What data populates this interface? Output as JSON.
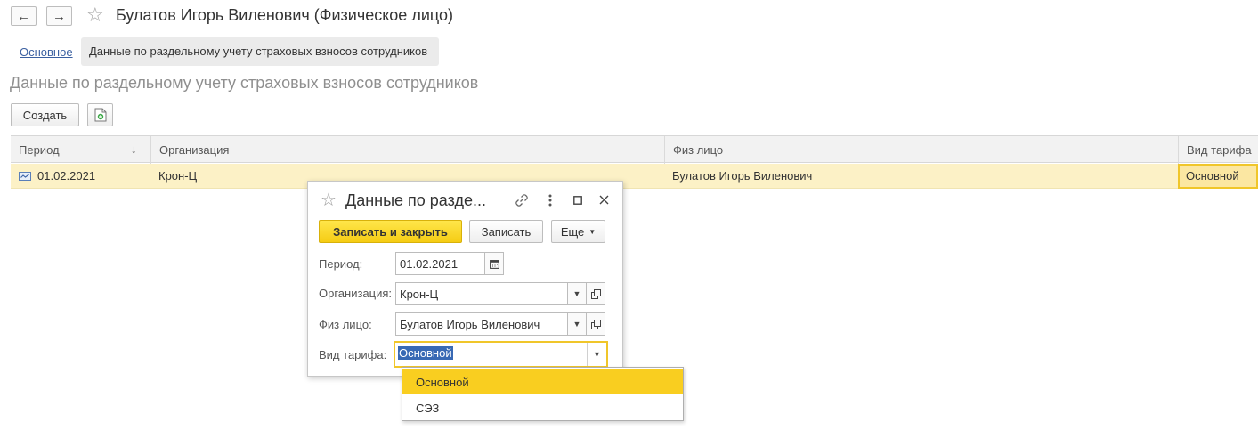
{
  "header": {
    "title": "Булатов Игорь Виленович (Физическое лицо)"
  },
  "tabs": [
    {
      "label": "Основное"
    },
    {
      "label": "Данные по раздельному учету страховых взносов сотрудников"
    }
  ],
  "section": {
    "title": "Данные по раздельному учету страховых взносов сотрудников"
  },
  "toolbar": {
    "create_label": "Создать"
  },
  "table": {
    "columns": [
      "Период",
      "Организация",
      "Физ лицо",
      "Вид тарифа"
    ],
    "sort_indicator": "↓",
    "rows": [
      {
        "period": "01.02.2021",
        "organization": "Крон-Ц",
        "person": "Булатов Игорь Виленович",
        "tariff": "Основной"
      }
    ]
  },
  "dialog": {
    "title": "Данные по разде...",
    "save_close_label": "Записать и закрыть",
    "save_label": "Записать",
    "more_label": "Еще",
    "fields": {
      "period_label": "Период:",
      "period_value": "01.02.2021",
      "org_label": "Организация:",
      "org_value": "Крон-Ц",
      "person_label": "Физ лицо:",
      "person_value": "Булатов Игорь Виленович",
      "tariff_label": "Вид тарифа:",
      "tariff_value": "Основной"
    }
  },
  "dropdown": {
    "options": [
      "Основной",
      "СЭЗ"
    ],
    "highlighted": "Основной"
  },
  "colors": {
    "accent": "#f9ce20",
    "row_highlight": "#fcf1c6",
    "link": "#3a5fa0",
    "selection": "#3869b4"
  }
}
